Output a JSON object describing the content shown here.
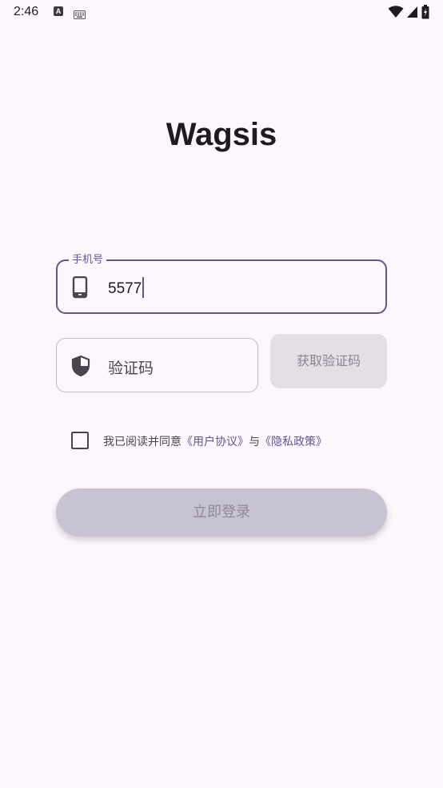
{
  "status_bar": {
    "time": "2:46",
    "notification_icons": [
      "a-badge-icon",
      "keyboard-icon"
    ],
    "system_icons": [
      "wifi-icon",
      "signal-icon",
      "battery-icon"
    ]
  },
  "app": {
    "title": "Wagsis"
  },
  "phone_field": {
    "label": "手机号",
    "value": "5577",
    "icon": "smartphone-icon"
  },
  "code_field": {
    "placeholder": "验证码",
    "icon": "shield-icon"
  },
  "get_code_button": {
    "label": "获取验证码",
    "enabled": false
  },
  "agreement": {
    "checked": false,
    "prefix": "我已阅读并同意",
    "user_agreement": "《用户协议》",
    "connector": "与",
    "privacy_policy": "《隐私政策》"
  },
  "login_button": {
    "label": "立即登录",
    "enabled": false
  },
  "colors": {
    "background": "#fdf7fd",
    "accent": "#65558f",
    "disabled_button": "#c8c3d2"
  }
}
